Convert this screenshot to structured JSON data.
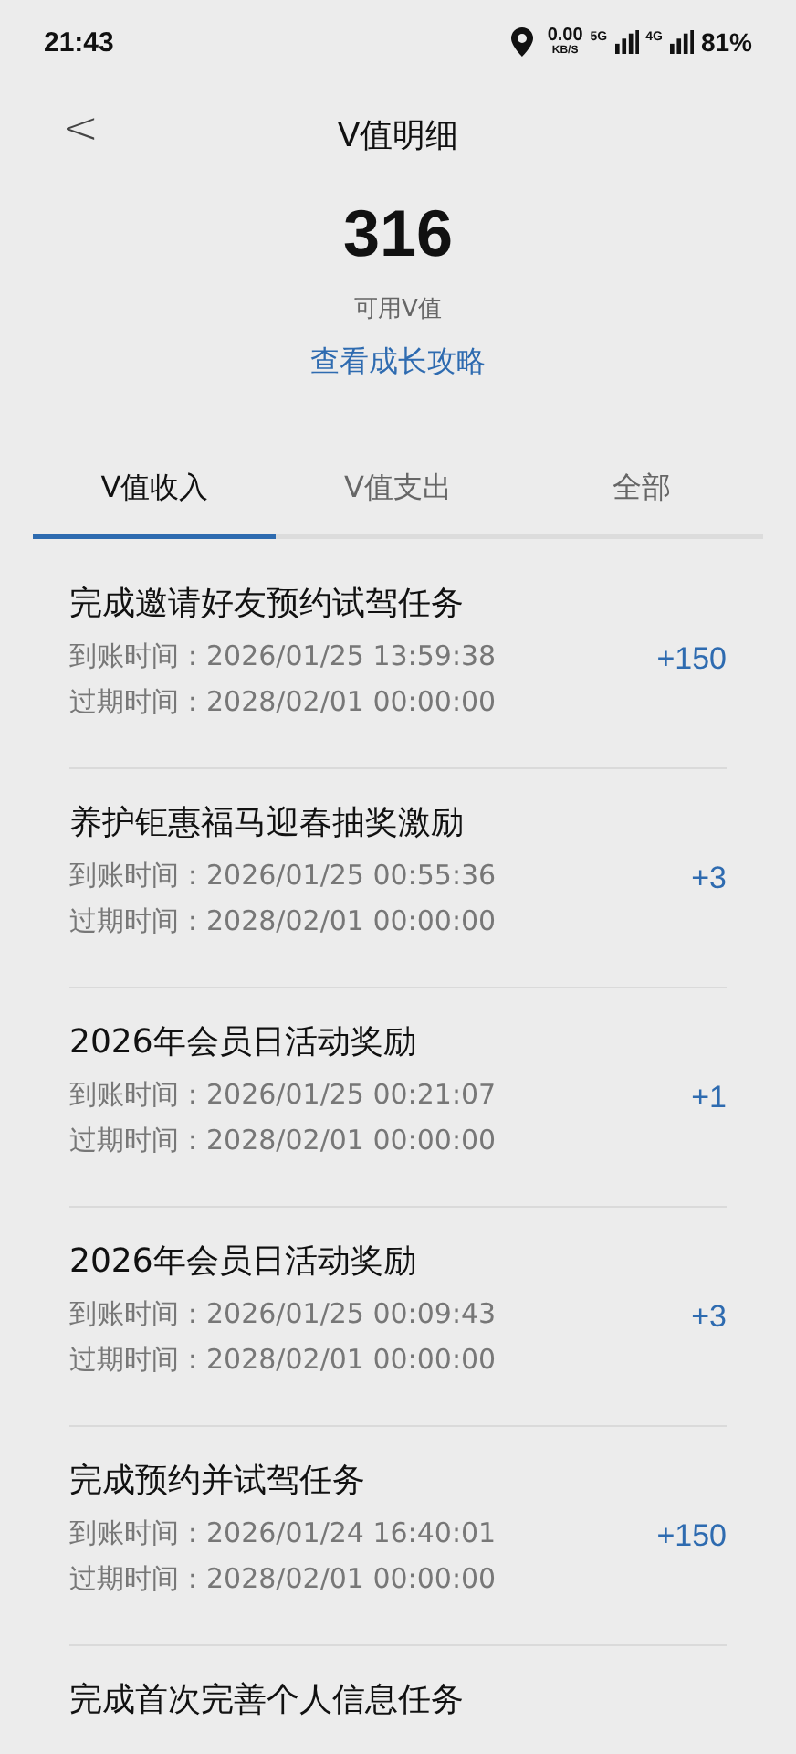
{
  "status_bar": {
    "time": "21:43",
    "speed_value": "0.00",
    "speed_unit": "KB/S",
    "network_1": "5G",
    "network_2": "4G",
    "battery": "81%"
  },
  "header": {
    "back": "<",
    "title": "V值明细"
  },
  "summary": {
    "value": "316",
    "label": "可用V值",
    "link": "查看成长攻略"
  },
  "tabs": [
    {
      "label": "V值收入",
      "selected": true
    },
    {
      "label": "V值支出",
      "selected": false
    },
    {
      "label": "全部",
      "selected": false
    }
  ],
  "records": [
    {
      "title": "完成邀请好友预约试驾任务",
      "credited": "到账时间：2026/01/25 13:59:38",
      "expires": "过期时间：2028/02/01 00:00:00",
      "amount": "+150"
    },
    {
      "title": "养护钜惠福马迎春抽奖激励",
      "credited": "到账时间：2026/01/25 00:55:36",
      "expires": "过期时间：2028/02/01 00:00:00",
      "amount": "+3"
    },
    {
      "title": "2026年会员日活动奖励",
      "credited": "到账时间：2026/01/25 00:21:07",
      "expires": "过期时间：2028/02/01 00:00:00",
      "amount": "+1"
    },
    {
      "title": "2026年会员日活动奖励",
      "credited": "到账时间：2026/01/25 00:09:43",
      "expires": "过期时间：2028/02/01 00:00:00",
      "amount": "+3"
    },
    {
      "title": "完成预约并试驾任务",
      "credited": "到账时间：2026/01/24 16:40:01",
      "expires": "过期时间：2028/02/01 00:00:00",
      "amount": "+150"
    },
    {
      "title": "完成首次完善个人信息任务"
    }
  ]
}
